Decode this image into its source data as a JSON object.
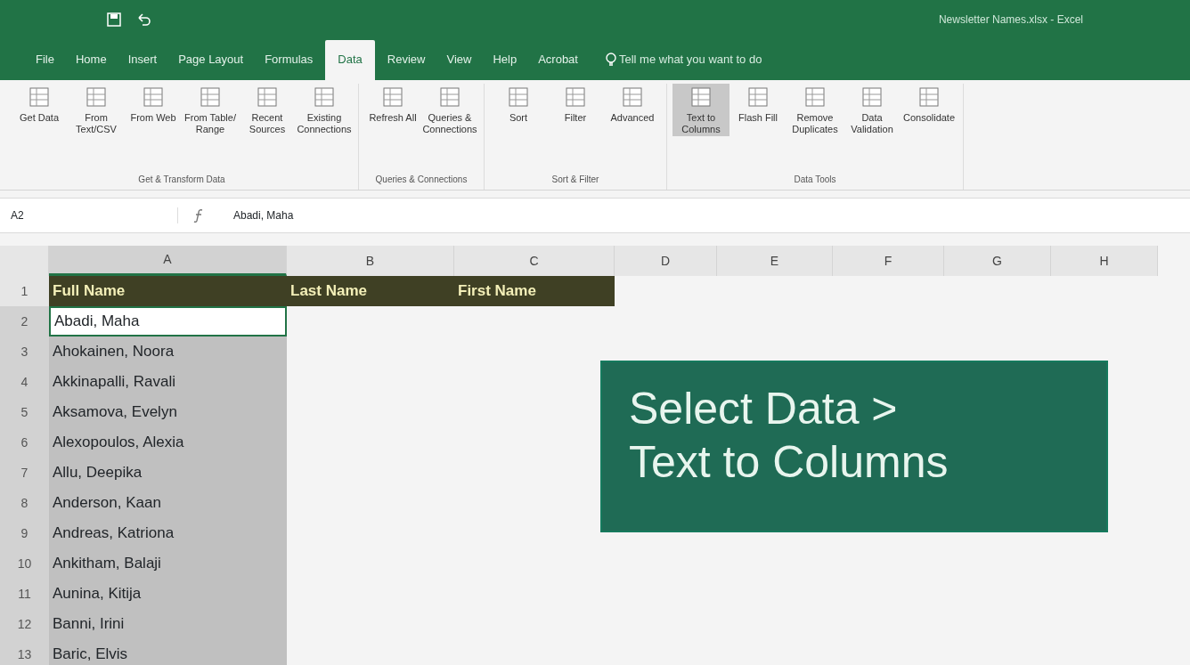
{
  "window": {
    "title": "Newsletter Names.xlsx - Excel"
  },
  "tabs": [
    {
      "label": "File",
      "selected": false
    },
    {
      "label": "Home",
      "selected": false
    },
    {
      "label": "Insert",
      "selected": false
    },
    {
      "label": "Page Layout",
      "selected": false
    },
    {
      "label": "Formulas",
      "selected": false
    },
    {
      "label": "Data",
      "selected": true
    },
    {
      "label": "Review",
      "selected": false
    },
    {
      "label": "View",
      "selected": false
    },
    {
      "label": "Help",
      "selected": false
    },
    {
      "label": "Acrobat",
      "selected": false
    }
  ],
  "tell_me": {
    "placeholder": "Tell me what you want to do"
  },
  "ribbon": {
    "groups": [
      {
        "label": "Get & Transform Data",
        "buttons": [
          {
            "label": "Get Data",
            "highlighted": false
          },
          {
            "label": "From Text/CSV",
            "highlighted": false
          },
          {
            "label": "From Web",
            "highlighted": false
          },
          {
            "label": "From Table/ Range",
            "highlighted": false
          },
          {
            "label": "Recent Sources",
            "highlighted": false
          },
          {
            "label": "Existing Connections",
            "highlighted": false
          }
        ]
      },
      {
        "label": "Queries & Connections",
        "buttons": [
          {
            "label": "Refresh All",
            "highlighted": false
          },
          {
            "label": "Queries & Connections",
            "highlighted": false
          }
        ]
      },
      {
        "label": "Sort & Filter",
        "buttons": [
          {
            "label": "Sort",
            "highlighted": false
          },
          {
            "label": "Filter",
            "highlighted": false
          },
          {
            "label": "Advanced",
            "highlighted": false
          }
        ]
      },
      {
        "label": "Data Tools",
        "buttons": [
          {
            "label": "Text to Columns",
            "highlighted": true
          },
          {
            "label": "Flash Fill",
            "highlighted": false
          },
          {
            "label": "Remove Duplicates",
            "highlighted": false
          },
          {
            "label": "Data Validation",
            "highlighted": false
          },
          {
            "label": "Consolidate",
            "highlighted": false
          }
        ]
      }
    ]
  },
  "formula_bar": {
    "name_box": "A2",
    "formula": "Abadi, Maha"
  },
  "sheet": {
    "columns": [
      {
        "label": "A",
        "selected": true
      },
      {
        "label": "B",
        "selected": false
      },
      {
        "label": "C",
        "selected": false
      },
      {
        "label": "D",
        "selected": false
      },
      {
        "label": "E",
        "selected": false
      },
      {
        "label": "F",
        "selected": false
      },
      {
        "label": "G",
        "selected": false
      },
      {
        "label": "H",
        "selected": false
      }
    ],
    "rows": [
      {
        "number": "1",
        "kind": "header",
        "cells": [
          "Full Name",
          "Last Name",
          "First Name"
        ]
      },
      {
        "number": "2",
        "kind": "data",
        "active": true,
        "cells": [
          "Abadi, Maha"
        ]
      },
      {
        "number": "3",
        "kind": "data",
        "active": false,
        "cells": [
          "Ahokainen, Noora"
        ]
      },
      {
        "number": "4",
        "kind": "data",
        "active": false,
        "cells": [
          "Akkinapalli, Ravali"
        ]
      },
      {
        "number": "5",
        "kind": "data",
        "active": false,
        "cells": [
          "Aksamova, Evelyn"
        ]
      },
      {
        "number": "6",
        "kind": "data",
        "active": false,
        "cells": [
          "Alexopoulos, Alexia"
        ]
      },
      {
        "number": "7",
        "kind": "data",
        "active": false,
        "cells": [
          "Allu, Deepika"
        ]
      },
      {
        "number": "8",
        "kind": "data",
        "active": false,
        "cells": [
          "Anderson, Kaan"
        ]
      },
      {
        "number": "9",
        "kind": "data",
        "active": false,
        "cells": [
          "Andreas, Katriona"
        ]
      },
      {
        "number": "10",
        "kind": "data",
        "active": false,
        "cells": [
          "Ankitham, Balaji"
        ]
      },
      {
        "number": "11",
        "kind": "data",
        "active": false,
        "cells": [
          "Aunina, Kitija"
        ]
      },
      {
        "number": "12",
        "kind": "data",
        "active": false,
        "cells": [
          "Banni, Irini"
        ]
      },
      {
        "number": "13",
        "kind": "data",
        "active": false,
        "cells": [
          "Baric, Elvis"
        ]
      }
    ]
  },
  "callout": {
    "lines": [
      "Select Data >",
      "Text to Columns"
    ]
  }
}
